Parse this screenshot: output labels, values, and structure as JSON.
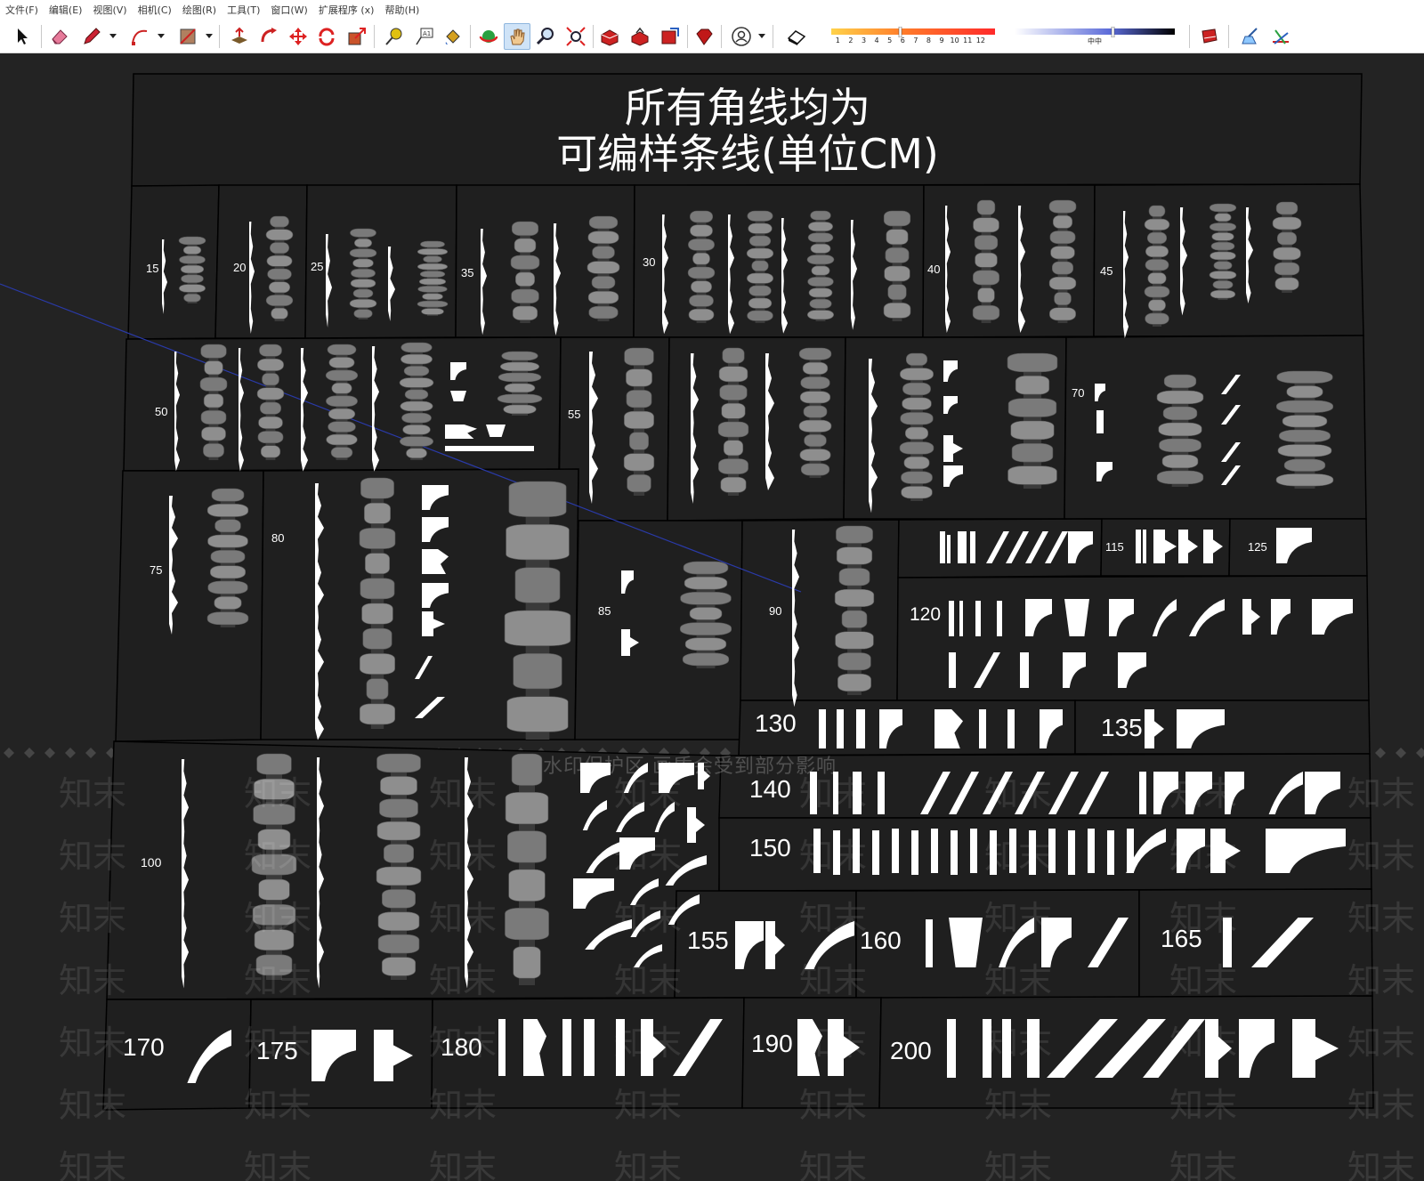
{
  "menu": [
    "文件(F)",
    "编辑(E)",
    "视图(V)",
    "相机(C)",
    "绘图(R)",
    "工具(T)",
    "窗口(W)",
    "扩展程序 (x)",
    "帮助(H)"
  ],
  "toolbar": {
    "scale_numbers": [
      "1",
      "2",
      "3",
      "4",
      "5",
      "6",
      "7",
      "8",
      "9",
      "10",
      "11",
      "12"
    ],
    "gradient_label": "中中"
  },
  "title": {
    "line1": "所有角线均为",
    "line2": "可编样条线(单位CM)"
  },
  "labels": {
    "p15": "15",
    "p20": "20",
    "p25": "25",
    "p35": "35",
    "p30": "30",
    "p40": "40",
    "p45": "45",
    "p50": "50",
    "p55": "55",
    "p70": "70",
    "p75": "75",
    "p80": "80",
    "p85": "85",
    "p90": "90",
    "p115": "115",
    "p125": "125",
    "p120": "120",
    "p130": "130",
    "p135": "135",
    "p100": "100",
    "p140": "140",
    "p150": "150",
    "p155": "155",
    "p160": "160",
    "p165": "165",
    "p170": "170",
    "p175": "175",
    "p180": "180",
    "p190": "190",
    "p200": "200"
  },
  "watermark": {
    "banner": "水印保护区  画质会受到部分影响",
    "brand": "知末"
  },
  "colors": {
    "background": "#232323",
    "panel_border": "#000000",
    "profile": "#ffffff",
    "baluster": "#8a8a8a",
    "guide_line": "#2a3aa8"
  }
}
